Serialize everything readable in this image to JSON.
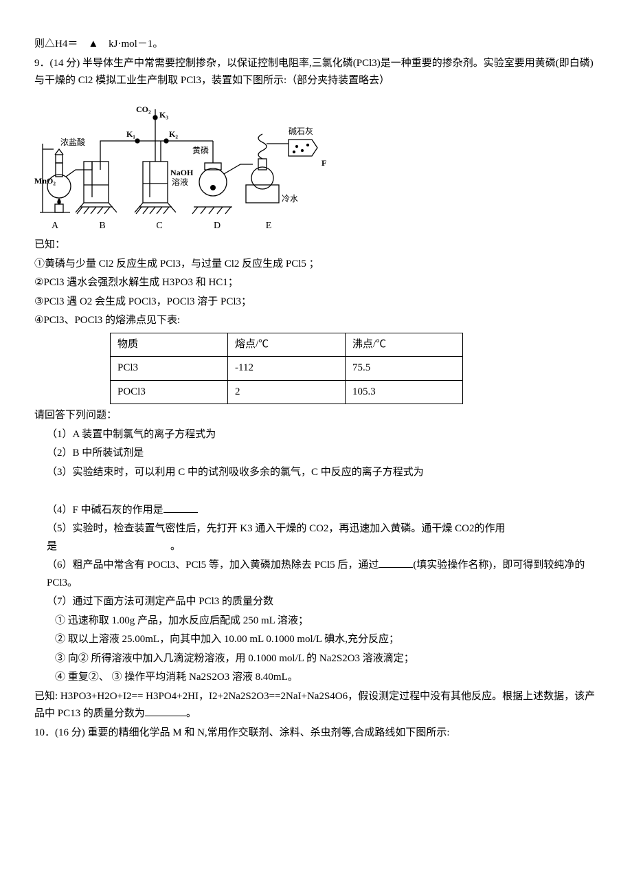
{
  "line_delta_h4": "则△H4＝ ▲ kJ·mol－1。",
  "q9_intro": "9．(14 分)  半导体生产中常需要控制掺杂，以保证控制电阻率,三氯化磷(PCl3)是一种重要的掺杂剂。实验室要用黄磷(即白磷)与干燥的 Cl2 模拟工业生产制取 PCl3，装置如下图所示:（部分夹持装置略去）",
  "fig": {
    "hcl": "浓盐酸",
    "mno2": "MnO₂",
    "co2": "CO₂",
    "k1": "K₁",
    "k2": "K₂",
    "k3": "K₃",
    "phos": "黄磷",
    "naoh_a": "NaOH",
    "naoh_b": "溶液",
    "lime": "碱石灰",
    "cold": "冷水",
    "F": "F",
    "labels": {
      "A": "A",
      "B": "B",
      "C": "C",
      "D": "D",
      "E": "E"
    }
  },
  "known_header": "已知：",
  "known": {
    "k1": "①黄磷与少量 Cl2 反应生成 PCl3，与过量 Cl2 反应生成 PCl5 ；",
    "k2": "②PCl3 遇水会强烈水解生成 H3PO3 和 HC1；",
    "k3": "③PCl3 遇 O2 会生成 POCl3，POCl3 溶于 PCl3；",
    "k4": "④PCl3、POCl3 的熔沸点见下表:"
  },
  "table": {
    "h_sub": "物质",
    "h_mp": "熔点/℃",
    "h_bp": "沸点/℃",
    "r1_sub": "PCl3",
    "r1_mp": "-112",
    "r1_bp": "75.5",
    "r2_sub": "POCl3",
    "r2_mp": "2",
    "r2_bp": "105.3"
  },
  "answer_header": "请回答下列问题：",
  "q": {
    "q1": "（1）A 装置中制氯气的离子方程式为",
    "q2": "（2）B 中所装试剂是",
    "q3": "（3）实验结束时，可以利用 C 中的试剂吸收多余的氯气，C 中反应的离子方程式为",
    "q4": "（4）F 中碱石灰的作用是",
    "q5": "（5）实验时，检查装置气密性后，先打开 K3 通入干燥的 CO2，再迅速加入黄磷。通干燥 CO2的作用是           。",
    "q6a": "（6）粗产品中常含有 POCl3、PCl5 等，加入黄磷加热除去 PCl5 后，通过",
    "q6b": "(填实验操作名称)，即可得到较纯净的 PCl3。",
    "q7h": "（7）通过下面方法可测定产品中 PCl3 的质量分数",
    "q7_1": "①  迅速称取 1.00g 产品，加水反应后配成 250 mL 溶液；",
    "q7_2": "②   取以上溶液 25.00mL，向其中加入 10.00 mL 0.1000 mol/L 碘水,充分反应；",
    "q7_3": "③   向②  所得溶液中加入几滴淀粉溶液，用 0.1000 mol/L 的 Na2S2O3 溶液滴定；",
    "q7_4": "④  重复②、 ③   操作平均消耗 Na2S2O3 溶液 8.40mL。",
    "q7end_a": "已知: H3PO3+H2O+I2== H3PO4+2HI，I2+2Na2S2O3==2NaI+Na2S4O6，假设测定过程中没有其他反应。根据上述数据，该产品中 PC13 的质量分数为",
    "q7end_b": "。"
  },
  "q10": "10．(16 分)  重要的精细化学品 M 和 N,常用作交联剂、涂料、杀虫剂等,合成路线如下图所示:"
}
